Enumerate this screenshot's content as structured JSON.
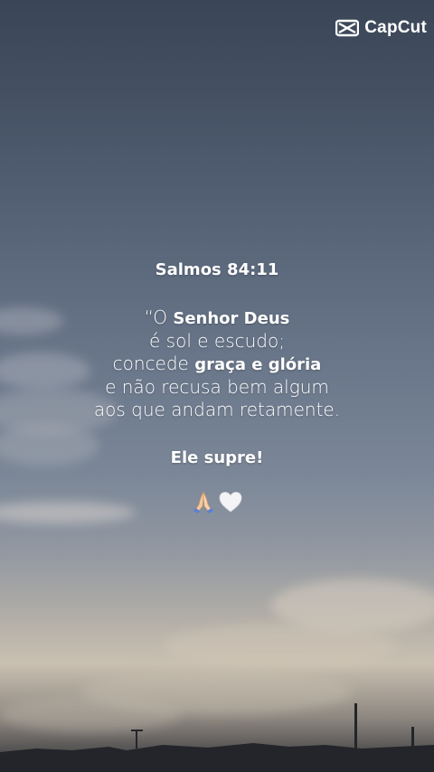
{
  "watermark": {
    "label": "CapCut",
    "icon": "capcut-logo-icon"
  },
  "verse": {
    "reference": "Salmos 84:11",
    "lines": [
      {
        "parts": [
          {
            "text": "“O ",
            "bold": false
          },
          {
            "text": "Senhor Deus",
            "bold": true
          }
        ]
      },
      {
        "parts": [
          {
            "text": "é sol e escudo;",
            "bold": false
          }
        ]
      },
      {
        "parts": [
          {
            "text": "concede ",
            "bold": false
          },
          {
            "text": "graça e glória",
            "bold": true
          }
        ]
      },
      {
        "parts": [
          {
            "text": "e não recusa bem algum",
            "bold": false
          }
        ]
      },
      {
        "parts": [
          {
            "text": "aos que andam retamente.",
            "bold": false
          }
        ]
      }
    ],
    "closing": "Ele supre!",
    "emojis": [
      "praying-hands-icon",
      "white-heart-icon"
    ]
  },
  "colors": {
    "text": "#ffffff",
    "sky_top": "#3a4556",
    "horizon": "#c9c0b1"
  }
}
